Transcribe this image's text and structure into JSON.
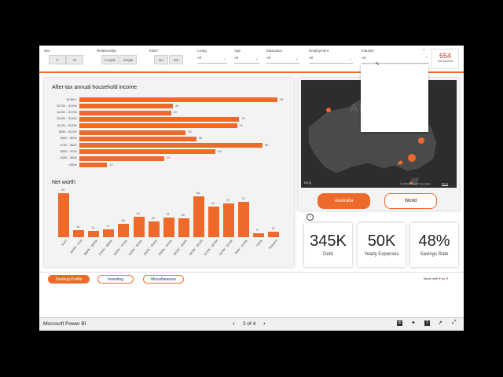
{
  "filters": {
    "sex": {
      "label": "Sex",
      "options": [
        "F",
        "M"
      ]
    },
    "relationship": {
      "label": "Relationship",
      "options": [
        "Couple",
        "Single"
      ]
    },
    "kids": {
      "label": "Kids?",
      "options": [
        "No",
        "Yes"
      ]
    },
    "living": {
      "label": "Living",
      "value": "All"
    },
    "age": {
      "label": "Age",
      "value": "All"
    },
    "education": {
      "label": "Education",
      "value": "All"
    },
    "employment": {
      "label": "Employment",
      "value": "All"
    },
    "industry": {
      "label": "Industry",
      "value": "All"
    }
  },
  "submissions": {
    "count": "654",
    "label": "Submissions"
  },
  "income_chart": {
    "title": "After-tax annual household income",
    "chart_data": {
      "type": "bar",
      "orientation": "horizontal",
      "categories": [
        "$195K+",
        "$175K - $195K",
        "$155K - $175K",
        "$135K - $155K",
        "$115K - $135K",
        "$95K - $115K",
        "$85K - $95K",
        "$75K - $85K",
        "$55K - $75K",
        "$35K - $55K",
        "<$35K"
      ],
      "values": [
        93,
        44,
        43,
        75,
        74,
        50,
        55,
        86,
        64,
        40,
        13
      ]
    }
  },
  "networth_chart": {
    "title": "Net worth",
    "chart_data": {
      "type": "bar",
      "categories": [
        "$1M+",
        "$900K - $1M",
        "$800K - $900K",
        "$700K - $800K",
        "$600K - $700K",
        "$500K - $600K",
        "$400K - $500K",
        "$300K - $400K",
        "$250K - $300K",
        "$200K - $250K",
        "$150K - $200K",
        "$100K - $150K",
        "$50K - $100K",
        "<$50K",
        "Negative"
      ],
      "values": [
        93,
        15,
        14,
        17,
        28,
        44,
        33,
        41,
        40,
        86,
        64,
        72,
        74,
        9,
        12
      ]
    }
  },
  "map": {
    "watermark": "AUSTRA",
    "bing": "Bing",
    "copyright": "© 2020 Microsoft Corporation",
    "terms": "Terms"
  },
  "region_buttons": {
    "australia": "Australia",
    "world": "World"
  },
  "info_icon": "i",
  "kpis": [
    {
      "value": "345K",
      "label": "Debt"
    },
    {
      "value": "50K",
      "label": "Yearly Expenses"
    },
    {
      "value": "48%",
      "label": "Savings Rate"
    }
  ],
  "page_tabs": [
    "Finebug Profile",
    "Investing",
    "Miscellaneous"
  ],
  "made_with": "Made with",
  "made_by": "by",
  "footer": {
    "app": "Microsoft Power BI",
    "page": "2 of 4"
  },
  "colors": {
    "accent": "#ee6a2a",
    "map_bg": "#2d2d2d",
    "submissions": "#c0392b"
  }
}
